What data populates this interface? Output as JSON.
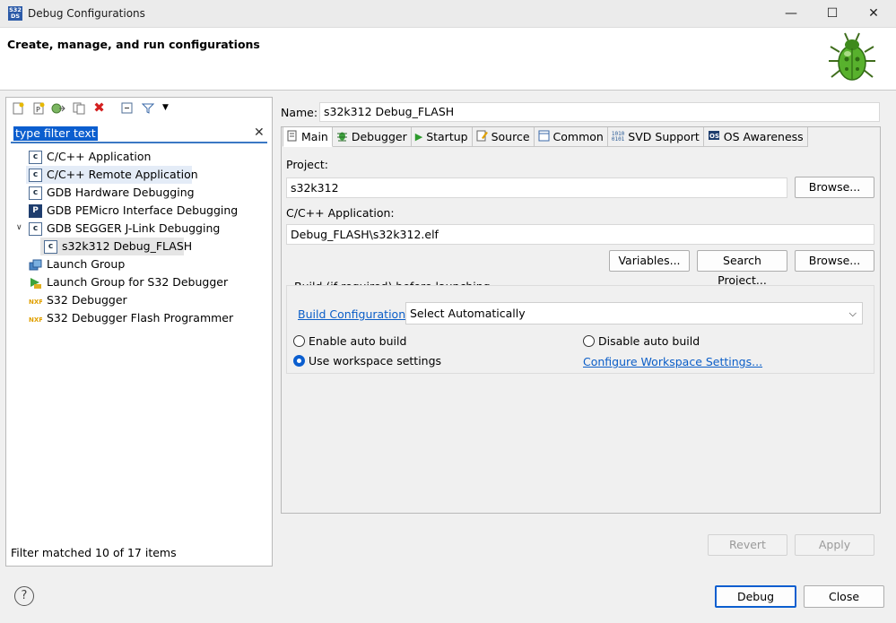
{
  "window": {
    "title": "Debug Configurations",
    "icon_text": "S32 DS",
    "minimize": "—",
    "maximize": "☐",
    "close": "✕"
  },
  "header": {
    "title": "Create, manage, and run configurations"
  },
  "left": {
    "filter_placeholder": "type filter text",
    "filter_value": "type filter text",
    "tree": [
      {
        "label": "C/C++ Application",
        "icon": "c-config-icon"
      },
      {
        "label": "C/C++ Remote Application",
        "icon": "c-config-icon"
      },
      {
        "label": "GDB Hardware Debugging",
        "icon": "c-config-icon"
      },
      {
        "label": "GDB PEMicro Interface Debugging",
        "icon": "pemicro-icon"
      },
      {
        "label": "GDB SEGGER J-Link Debugging",
        "icon": "c-config-icon"
      },
      {
        "label": "s32k312 Debug_FLASH",
        "icon": "c-config-icon"
      },
      {
        "label": "Launch Group",
        "icon": "launch-group-icon"
      },
      {
        "label": "Launch Group for S32 Debugger",
        "icon": "launch-group-icon"
      },
      {
        "label": "S32 Debugger",
        "icon": "s32-debugger-icon"
      },
      {
        "label": "S32 Debugger Flash Programmer",
        "icon": "s32-debugger-icon"
      }
    ],
    "status": "Filter matched 10 of 17 items"
  },
  "right": {
    "name_label": "Name:",
    "name_value": "s32k312 Debug_FLASH",
    "tabs": [
      "Main",
      "Debugger",
      "Startup",
      "Source",
      "Common",
      "SVD Support",
      "OS Awareness"
    ],
    "project_label": "Project:",
    "project_value": "s32k312",
    "browse_label": "Browse...",
    "app_label": "C/C++ Application:",
    "app_value": "Debug_FLASH\\s32k312.elf",
    "variables_label": "Variables...",
    "search_project_label": "Search Project...",
    "build_group_title": "Build (if required) before launching",
    "build_config_link": "Build Configuration:",
    "build_config_value": "Select Automatically",
    "enable_auto_build": "Enable auto build",
    "disable_auto_build": "Disable auto build",
    "use_workspace": "Use workspace settings",
    "configure_workspace": "Configure Workspace Settings...",
    "revert_label": "Revert",
    "apply_label": "Apply"
  },
  "footer": {
    "debug_label": "Debug",
    "close_label": "Close",
    "help_glyph": "?"
  }
}
